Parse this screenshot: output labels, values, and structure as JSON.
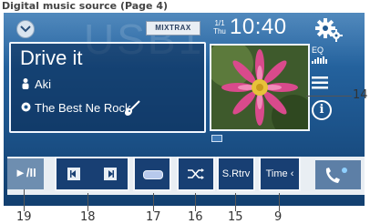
{
  "caption": "Digital music source (Page 4)",
  "source_watermark": "USB1",
  "status": {
    "mixtrax_label": "MIXTRAX",
    "date_day": "1/1",
    "date_weekday": "Thu",
    "clock": "10:40"
  },
  "track": {
    "title": "Drive it",
    "artist": "Aki",
    "album": "The Best Ne   Rock"
  },
  "side_buttons": {
    "eq_label": "EQ"
  },
  "controls": {
    "play_pause_label": "►/II",
    "sound_retriever_label": "S.Rtrv",
    "time_label": "Time ‹"
  },
  "callouts": {
    "c19": "19",
    "c18": "18",
    "c17": "17",
    "c16": "16",
    "c15": "15",
    "c9": "9",
    "c14": "14"
  },
  "colors": {
    "screen_top": "#2b6fae",
    "screen_bottom": "#123f6f",
    "button_dark": "#183f73",
    "accent_light": "#e9eef3"
  },
  "icons": [
    "chevron-down-icon",
    "settings-gear-icon",
    "person-icon",
    "disc-icon",
    "guitar-icon",
    "eq-bars-icon",
    "list-icon",
    "info-icon",
    "skip-prev-icon",
    "skip-next-icon",
    "repeat-icon",
    "shuffle-icon",
    "phone-icon"
  ]
}
